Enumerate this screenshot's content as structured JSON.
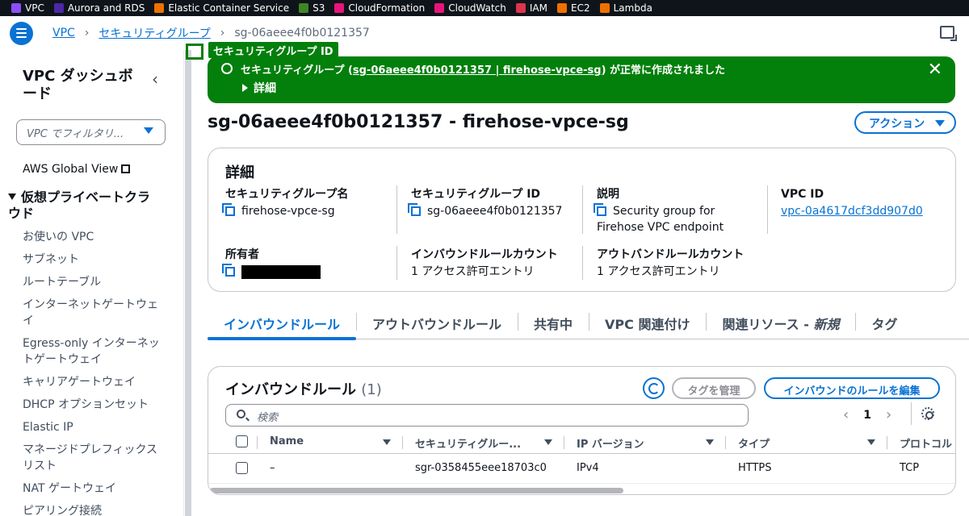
{
  "service_bar": [
    {
      "label": "VPC",
      "icon": "vpc-icon",
      "color": "#8c4fff"
    },
    {
      "label": "Aurora and RDS",
      "icon": "rds-icon",
      "color": "#4d27aa"
    },
    {
      "label": "Elastic Container Service",
      "icon": "ecs-icon",
      "color": "#ed7100"
    },
    {
      "label": "S3",
      "icon": "s3-icon",
      "color": "#3f8624"
    },
    {
      "label": "CloudFormation",
      "icon": "cloudformation-icon",
      "color": "#e7157b"
    },
    {
      "label": "CloudWatch",
      "icon": "cloudwatch-icon",
      "color": "#e7157b"
    },
    {
      "label": "IAM",
      "icon": "iam-icon",
      "color": "#dd344c"
    },
    {
      "label": "EC2",
      "icon": "ec2-icon",
      "color": "#ed7100"
    },
    {
      "label": "Lambda",
      "icon": "lambda-icon",
      "color": "#ed7100"
    }
  ],
  "breadcrumb": {
    "items": [
      "VPC",
      "セキュリティグループ"
    ],
    "current": "sg-06aeee4f0b0121357"
  },
  "sidebar": {
    "title": "VPC ダッシュボード",
    "filter_placeholder": "VPC でフィルタリ...",
    "global_view": "AWS Global View",
    "section": "仮想プライベートクラウド",
    "items": [
      "お使いの VPC",
      "サブネット",
      "ルートテーブル",
      "インターネットゲートウェイ",
      "Egress-only インターネットゲートウェイ",
      "キャリアゲートウェイ",
      "DHCP オプションセット",
      "Elastic IP",
      "マネージドプレフィックスリスト",
      "NAT ゲートウェイ",
      "ピアリング接続"
    ]
  },
  "tooltip": {
    "label": "セキュリティグループ ID"
  },
  "flash": {
    "prefix": "セキュリティグループ (",
    "link": "sg-06aeee4f0b0121357 | firehose-vpce-sg",
    "suffix": ") が正常に作成されました",
    "details": "詳細",
    "color": "#037f0c"
  },
  "page": {
    "title": "sg-06aeee4f0b0121357 - firehose-vpce-sg",
    "action_button": "アクション"
  },
  "details": {
    "heading": "詳細",
    "sg_name_label": "セキュリティグループ名",
    "sg_name_value": "firehose-vpce-sg",
    "sg_id_label": "セキュリティグループ ID",
    "sg_id_value": "sg-06aeee4f0b0121357",
    "desc_label": "説明",
    "desc_value": "Security group for Firehose VPC endpoint",
    "vpc_id_label": "VPC ID",
    "vpc_id_value": "vpc-0a4617dcf3dd907d0",
    "owner_label": "所有者",
    "inbound_count_label": "インバウンドルールカウント",
    "inbound_count_value": "1 アクセス許可エントリ",
    "outbound_count_label": "アウトバンドルールカウント",
    "outbound_count_value": "1 アクセス許可エントリ"
  },
  "tabs": [
    {
      "label": "インバウンドルール",
      "active": true
    },
    {
      "label": "アウトバウンドルール"
    },
    {
      "label": "共有中"
    },
    {
      "label": "VPC 関連付け"
    },
    {
      "label": "関連リソース - ",
      "suffix": "新規"
    },
    {
      "label": "タグ"
    }
  ],
  "inbound": {
    "title": "インバウンドルール",
    "count": "(1)",
    "manage_tags": "タグを管理",
    "edit_rules": "インバウンドのルールを編集",
    "search_placeholder": "検索",
    "page": "1",
    "columns": [
      "Name",
      "セキュリティグルー...",
      "IP バージョン",
      "タイプ",
      "プロトコル"
    ],
    "rows": [
      {
        "name": "–",
        "rule_id": "sgr-0358455eee18703c0",
        "ip_version": "IPv4",
        "type": "HTTPS",
        "protocol": "TCP"
      }
    ]
  }
}
